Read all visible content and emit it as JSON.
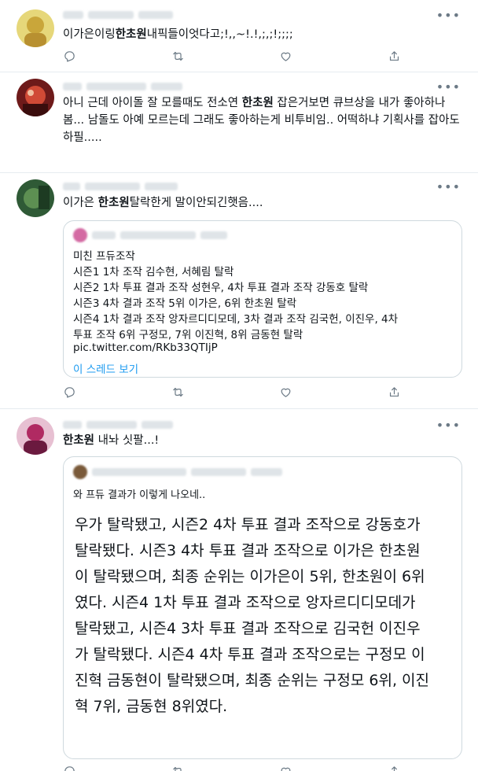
{
  "tweets": [
    {
      "text_before": "이가은이링",
      "highlight": "한초원",
      "text_after": "내픽들이엇다고;!,,~!.!,;,;!;;;;",
      "avatar_color": "#d9c14a"
    },
    {
      "text_before": "아니 근데 아이돌 잘 모를때도 전소연 ",
      "highlight": "한초원",
      "text_after": " 잡은거보면 큐브상을 내가 좋아하나봄... 남돌도 아예 모르는데 그래도 좋아하는게 비투비임.. 어떡하냐 기획사를 잡아도 하필.....",
      "avatar_color": "#b8322b"
    },
    {
      "text_before": "이가은 ",
      "highlight": "한초원",
      "text_after": "탈락한게 말이안되긴햇음....",
      "avatar_color": "#3f6b45",
      "quote": {
        "lines": [
          "미친 프듀조작",
          "시즌1 1차 조작 김수현, 서혜림 탈락",
          "시즌2 1차 투표 결과 조작 성현우, 4차 투표 결과 조작 강동호 탈락",
          "시즌3 4차 결과 조작 5위 이가은, 6위 한초원 탈락",
          "시즌4 1차 결과 조작 앙자르디디모데, 3차 결과 조작 김국헌, 이진우, 4차",
          "투표 조작 6위 구정모, 7위 이진혁, 8위 금동현 탈락"
        ],
        "link": "pic.twitter.com/RKb33QTIjP",
        "show_thread": "이 스레드 보기"
      }
    },
    {
      "highlight": "한초원",
      "text_after": " 내놔 싯팔...!",
      "avatar_color": "#c23a6e",
      "quote": {
        "subtitle": "와 프듀 결과가 이렇게 나오네..",
        "image_lines": [
          "우가 탈락됐고, 시즌2 4차 투표 결과 조작으로 강동호가",
          "탈락됐다. 시즌3 4차 투표 결과 조작으로 이가은 한초원",
          "이 탈락됐으며, 최종 순위는 이가은이 5위, 한초원이 6위",
          "였다. 시즌4 1차 투표 결과 조작으로 앙자르디디모데가",
          "탈락됐고, 시즌4 3차 투표 결과 조작으로 김국헌 이진우",
          "가 탈락됐다. 시즌4 4차 투표 결과 조작으로는 구정모 이",
          "진혁 금동현이 탈락됐으며, 최종 순위는 구정모 6위, 이진",
          "혁 7위, 금동현 8위였다."
        ]
      }
    }
  ]
}
